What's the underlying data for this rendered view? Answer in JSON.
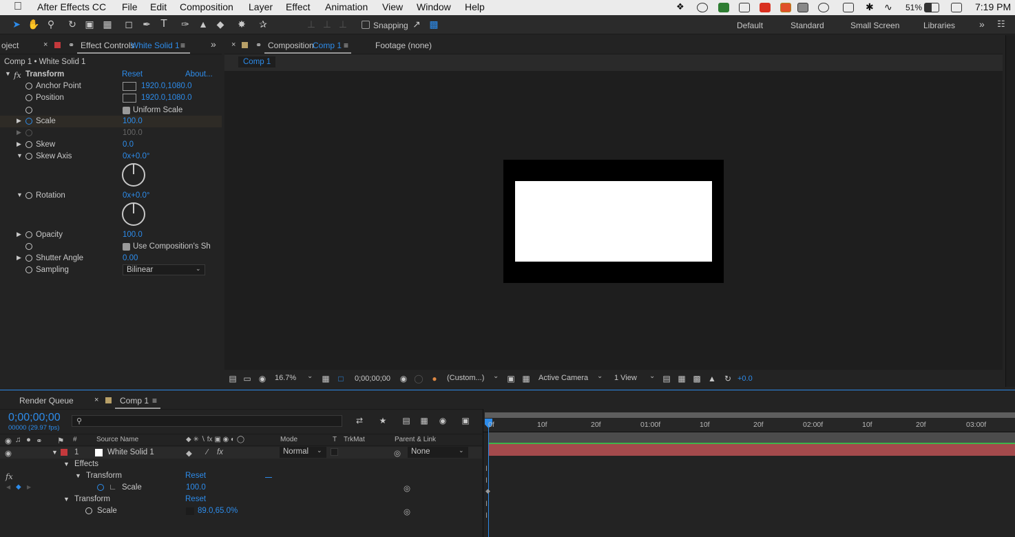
{
  "menubar": {
    "app": "After Effects CC",
    "menus": [
      "File",
      "Edit",
      "Composition",
      "Layer",
      "Effect",
      "Animation",
      "View",
      "Window",
      "Help"
    ],
    "battery": "51%",
    "time": "7:19 PM"
  },
  "toolbar": {
    "snapping": "Snapping",
    "workspaces": [
      "Default",
      "Standard",
      "Small Screen",
      "Libraries"
    ]
  },
  "effect_panel": {
    "left_tab": "oject",
    "tab_label": "Effect Controls",
    "tab_layer": "White Solid 1",
    "breadcrumb": "Comp 1 • White Solid 1",
    "effect_name": "Transform",
    "reset": "Reset",
    "about": "About...",
    "props": {
      "anchor_label": "Anchor Point",
      "anchor_value": "1920.0,1080.0",
      "position_label": "Position",
      "position_value": "1920.0,1080.0",
      "uniform_label": "Uniform Scale",
      "scale_label": "Scale",
      "scale_value": "100.0",
      "scale_width_value": "100.0",
      "skew_label": "Skew",
      "skew_value": "0.0",
      "skew_axis_label": "Skew Axis",
      "skew_axis_value": "0x+0.0°",
      "rotation_label": "Rotation",
      "rotation_value": "0x+0.0°",
      "opacity_label": "Opacity",
      "opacity_value": "100.0",
      "use_comp_label": "Use Composition's Sh",
      "shutter_label": "Shutter Angle",
      "shutter_value": "0.00",
      "sampling_label": "Sampling",
      "sampling_value": "Bilinear"
    }
  },
  "comp_panel": {
    "tab_label": "Composition",
    "tab_comp": "Comp 1",
    "footage_tab": "Footage (none)",
    "subtab": "Comp 1",
    "zoom": "16.7%",
    "timecode": "0;00;00;00",
    "resolution": "(Custom...)",
    "camera": "Active Camera",
    "views": "1 View",
    "exposure": "+0.0"
  },
  "timeline": {
    "render_queue_tab": "Render Queue",
    "comp_tab": "Comp 1",
    "timecode": "0;00;00;00",
    "fps": "00000 (29.97 fps)",
    "columns": {
      "num": "#",
      "source_name": "Source Name",
      "mode": "Mode",
      "t": "T",
      "trkmat": "TrkMat",
      "parent": "Parent & Link"
    },
    "layer": {
      "index": "1",
      "name": "White Solid 1",
      "mode": "Normal",
      "parent": "None"
    },
    "effects_label": "Effects",
    "effect_transform": "Transform",
    "effect_reset": "Reset",
    "effect_scale_label": "Scale",
    "effect_scale_value": "100.0",
    "transform_label": "Transform",
    "transform_reset": "Reset",
    "transform_scale_label": "Scale",
    "transform_scale_value": "89.0,65.0%",
    "ruler": [
      "0f",
      "10f",
      "20f",
      "01:00f",
      "10f",
      "20f",
      "02:00f",
      "10f",
      "20f",
      "03:00f"
    ]
  },
  "colors": {
    "accent": "#2d8ceb",
    "layer_label": "#c4393c",
    "layer_bar": "#a44a4c",
    "layer_bar_top": "#3db54a",
    "panel_bg": "#232323",
    "comp_bg": "#1e1e1e"
  }
}
